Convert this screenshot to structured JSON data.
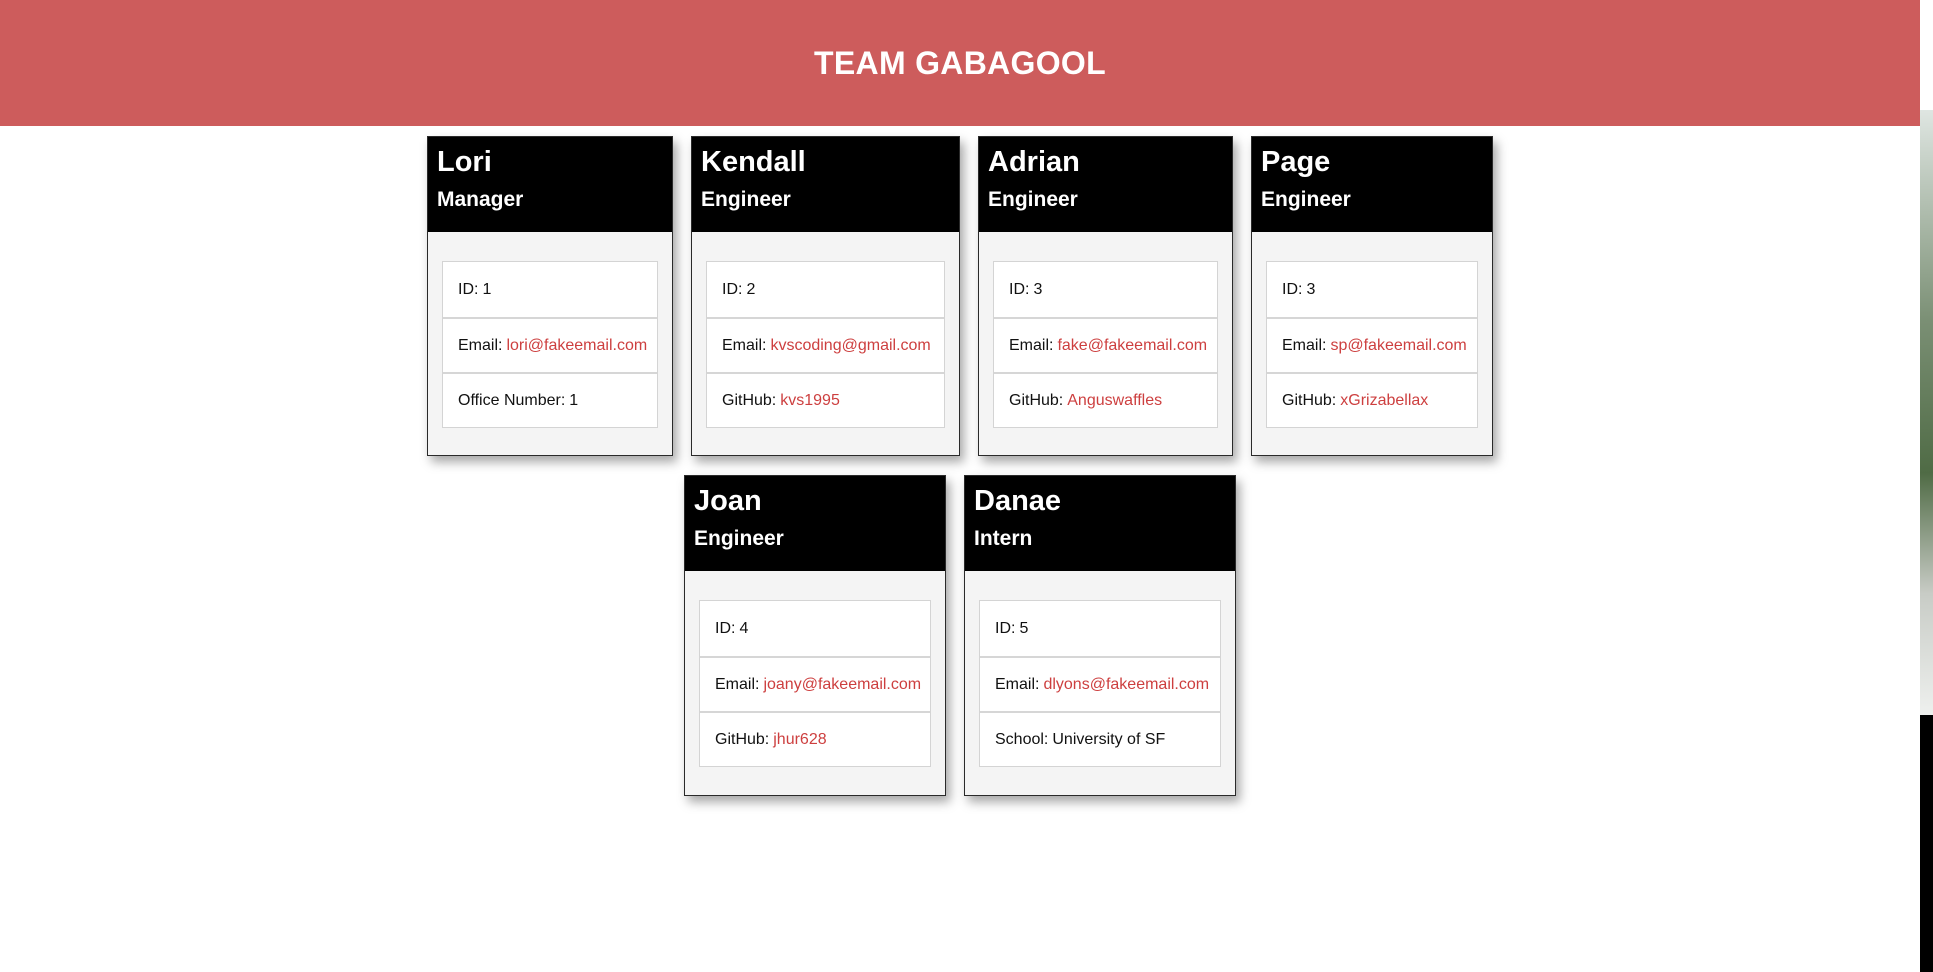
{
  "header": {
    "title": "TEAM GABAGOOL"
  },
  "colors": {
    "banner": "#cd5c5c",
    "card_header": "#000000",
    "link": "#cd3f3f"
  },
  "cards": [
    {
      "name": "Lori",
      "role": "Manager",
      "id_label": "ID:",
      "id": "1",
      "email_label": "Email:",
      "email": "lori@fakeemail.com",
      "extra_label": "Office Number:",
      "extra": "1"
    },
    {
      "name": "Kendall",
      "role": "Engineer",
      "id_label": "ID:",
      "id": "2",
      "email_label": "Email:",
      "email": "kvscoding@gmail.com",
      "extra_label": "GitHub:",
      "extra": "kvs1995"
    },
    {
      "name": "Adrian",
      "role": "Engineer",
      "id_label": "ID:",
      "id": "3",
      "email_label": "Email:",
      "email": "fake@fakeemail.com",
      "extra_label": "GitHub:",
      "extra": "Anguswaffles"
    },
    {
      "name": "Page",
      "role": "Engineer",
      "id_label": "ID:",
      "id": "3",
      "email_label": "Email:",
      "email": "sp@fakeemail.com",
      "extra_label": "GitHub:",
      "extra": "xGrizabellax"
    },
    {
      "name": "Joan",
      "role": "Engineer",
      "id_label": "ID:",
      "id": "4",
      "email_label": "Email:",
      "email": "joany@fakeemail.com",
      "extra_label": "GitHub:",
      "extra": "jhur628"
    },
    {
      "name": "Danae",
      "role": "Intern",
      "id_label": "ID:",
      "id": "5",
      "email_label": "Email:",
      "email": "dlyons@fakeemail.com",
      "extra_label": "School:",
      "extra": "University of SF"
    }
  ]
}
